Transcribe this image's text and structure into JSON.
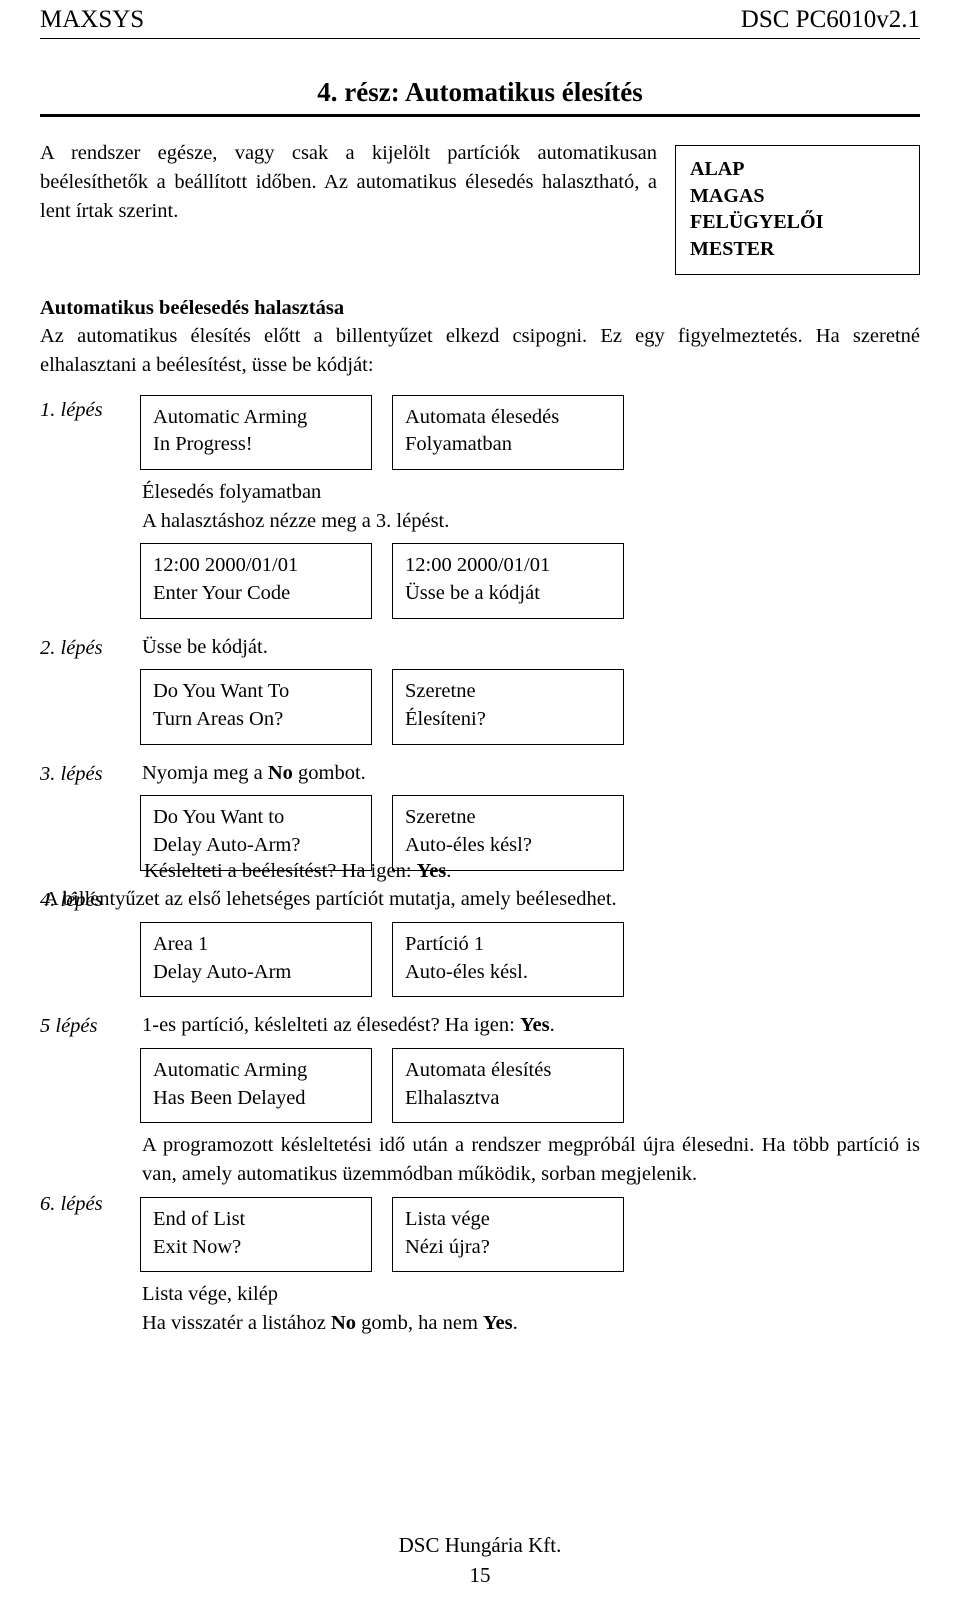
{
  "header": {
    "left": "MAXSYS",
    "right": "DSC PC6010v2.1"
  },
  "title": "4. rész: Automatikus élesítés",
  "intro": {
    "text": "A rendszer egésze, vagy csak a kijelölt partíciók automatikusan beélesíthetők a beállított időben. Az automatikus élesedés halasztható, a lent írtak szerint.",
    "levels": [
      "ALAP",
      "MAGAS",
      "FELÜGYELŐI",
      "MESTER"
    ]
  },
  "section": {
    "heading": "Automatikus beélesedés halasztása",
    "paragraph": "Az automatikus élesítés előtt a billentyűzet elkezd csipogni. Ez egy figyelmeztetés. Ha szeretné elhalasztani a beélesítést, üsse be kódját:"
  },
  "steps": [
    {
      "label": "1. lépés",
      "lcd_a_line1": "Automatic Arming",
      "lcd_a_line2": "In Progress!",
      "lcd_b_line1": "Automata élesedés",
      "lcd_b_line2": "Folyamatban",
      "note1": "Élesedés folyamatban",
      "note2": "A halasztáshoz nézze meg a 3. lépést.",
      "lcd2_a_line1": "12:00  2000/01/01",
      "lcd2_a_line2": "Enter Your Code",
      "lcd2_b_line1": "12:00  2000/01/01",
      "lcd2_b_line2": "Üsse be a kódját"
    },
    {
      "label": "2. lépés",
      "note": "Üsse be kódját.",
      "lcd_a_line1": "Do You Want To",
      "lcd_a_line2": "Turn Areas On?",
      "lcd_b_line1": "Szeretne",
      "lcd_b_line2": "Élesíteni?"
    },
    {
      "label": "3. lépés",
      "note_pre": "Nyomja meg a ",
      "note_bold": "No",
      "note_post": " gombot.",
      "lcd_a_line1": "Do You Want to",
      "lcd_a_line2": "Delay Auto-Arm?",
      "lcd_b_line1": "Szeretne",
      "lcd_b_line2": "Auto-éles késl?"
    },
    {
      "label": "4. lépés",
      "note_pre": "Késlelteti a beélesítést? Ha igen: ",
      "note_bold": "Yes",
      "note_post": ".",
      "note2": "A billentyűzet az első lehetséges partíciót mutatja, amely beélesedhet.",
      "lcd_a_line1": "Area 1",
      "lcd_a_line2": "Delay Auto-Arm",
      "lcd_b_line1": "Partíció 1",
      "lcd_b_line2": "Auto-éles késl."
    },
    {
      "label": "5 lépés",
      "note_pre": "1-es partíció, késlelteti az élesedést? Ha igen: ",
      "note_bold": "Yes",
      "note_post": ".",
      "lcd_a_line1": "Automatic Arming",
      "lcd_a_line2": "Has Been Delayed",
      "lcd_b_line1": "Automata élesítés",
      "lcd_b_line2": "Elhalasztva"
    },
    {
      "label": "6. lépés",
      "note_top": "A programozott késleltetési idő után a rendszer megpróbál újra élesedni. Ha több partíció is van, amely automatikus üzemmódban működik, sorban megjelenik.",
      "lcd_a_line1": "End of List",
      "lcd_a_line2": "Exit Now?",
      "lcd_b_line1": "Lista vége",
      "lcd_b_line2": "Nézi újra?",
      "note_end1": "Lista vége, kilép",
      "note_end2_pre": "Ha visszatér a listához ",
      "note_end2_b1": "No",
      "note_end2_mid": " gomb, ha nem ",
      "note_end2_b2": "Yes",
      "note_end2_post": "."
    }
  ],
  "footer": {
    "company": "DSC Hungária Kft.",
    "page": "15"
  }
}
